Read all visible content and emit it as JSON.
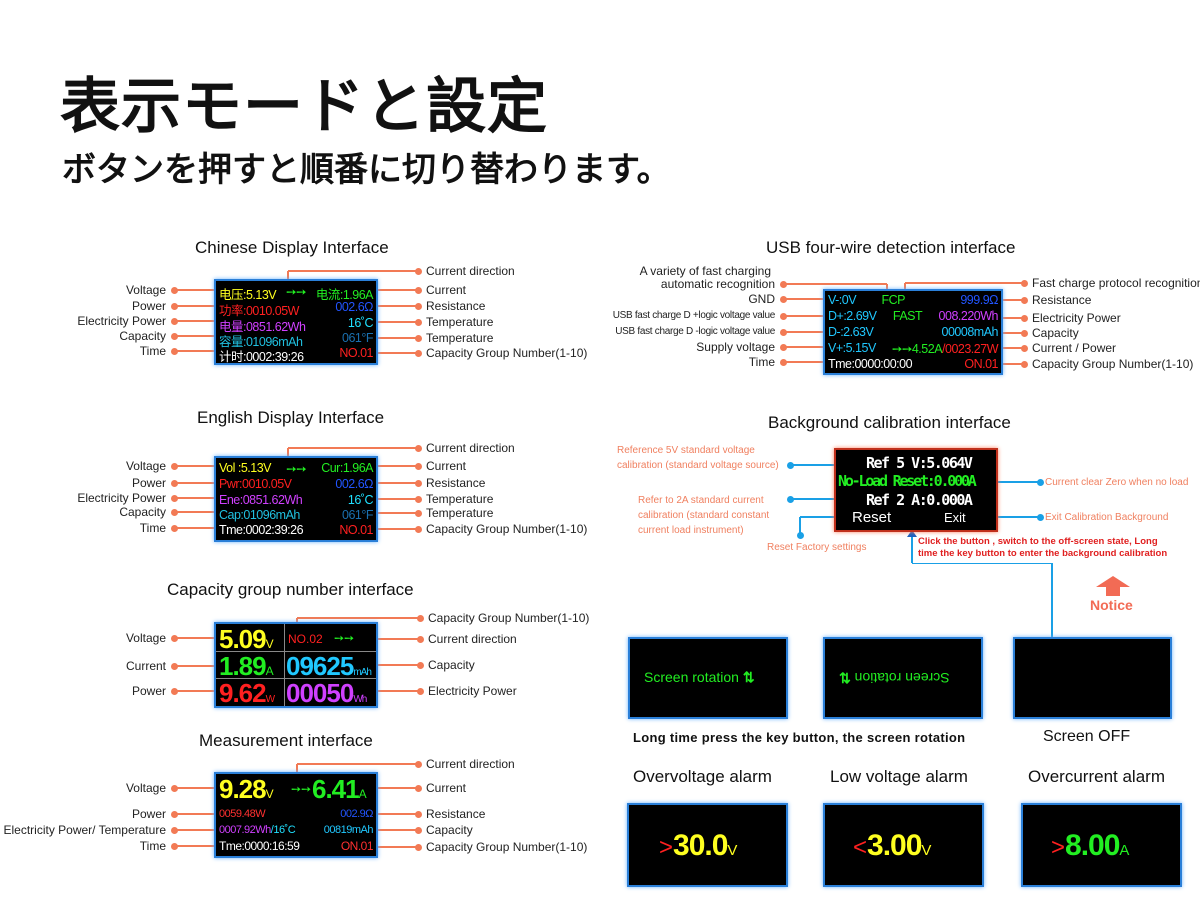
{
  "header": {
    "title": "表示モードと設定",
    "subtitle": "ボタンを押すと順番に切り替わります。"
  },
  "colors": {
    "label_line": "#f27a55",
    "calib_line": "#1aa0e6",
    "yellow": "#ffff20",
    "green": "#22ee22",
    "red": "#ff2020",
    "blue": "#2255ff",
    "cyan": "#20d0ff",
    "magenta": "#d040ff",
    "white": "#ffffff",
    "notice": "#f26b55"
  },
  "chinese": {
    "title": "Chinese Display Interface",
    "screen": {
      "r1l": "电压:5.13V",
      "arrow": "➙➙",
      "r1r": "电流:1.96A",
      "r2l": "功率:0010.05W",
      "r2r": "002.6Ω",
      "r3l": "电量:0851.62Wh",
      "r3r": "16˚C",
      "r4l": "容量:01096mAh",
      "r4r": "061°F",
      "r5l": "计时:0002:39:26",
      "r5r": "NO.01"
    },
    "left": [
      "Voltage",
      "Power",
      "Electricity Power",
      "Capacity",
      "Time"
    ],
    "right": [
      "Current direction",
      "Current",
      "Resistance",
      "Temperature",
      "Temperature",
      "Capacity Group Number(1-10)"
    ]
  },
  "english": {
    "title": "English Display Interface",
    "screen": {
      "r1l": "Vol :5.13V",
      "arrow": "➙➙",
      "r1r": "Cur:1.96A",
      "r2l": "Pwr:0010.05V",
      "r2r": "002.6Ω",
      "r3l": "Ene:0851.62Wh",
      "r3r": "16˚C",
      "r4l": "Cap:01096mAh",
      "r4r": "061°F",
      "r5l": "Tme:0002:39:26",
      "r5r": "NO.01"
    },
    "left": [
      "Voltage",
      "Power",
      "Electricity Power",
      "Capacity",
      "Time"
    ],
    "right": [
      "Current direction",
      "Current",
      "Resistance",
      "Temperature",
      "Temperature",
      "Capacity Group Number(1-10)"
    ]
  },
  "group": {
    "title": "Capacity group number interface",
    "screen": {
      "v": "5.09",
      "vu": "V",
      "no": "NO.02",
      "arrow": "➙➙",
      "a": "1.89",
      "au": "A",
      "cap": "09625",
      "capu": "mAh",
      "w": "9.62",
      "wu": "W",
      "wh": "00050",
      "whu": "Wh"
    },
    "left": [
      "Voltage",
      "Current",
      "Power"
    ],
    "right": [
      "Capacity Group Number(1-10)",
      "Current direction",
      "Capacity",
      "Electricity Power"
    ]
  },
  "measure": {
    "title": "Measurement interface",
    "screen": {
      "v": "9.28",
      "vu": "V",
      "arrow": "➙➙",
      "a": "6.41",
      "au": "A",
      "r2l": "0059.48W",
      "r2r": "002.9Ω",
      "r3l": "0007.92Wh",
      "r3m": "/16˚C",
      "r3r": "00819mAh",
      "r4l": "Tme:0000:16:59",
      "r4r": "ON.01"
    },
    "left": [
      "Voltage",
      "Power",
      "Electricity Power/ Temperature",
      "Time"
    ],
    "right": [
      "Current direction",
      "Current",
      "Resistance",
      "Capacity",
      "Capacity Group Number(1-10)"
    ]
  },
  "usb": {
    "title": "USB four-wire detection interface",
    "screen": {
      "r1l": "V-:0V",
      "r1m": "FCP",
      "r1r": "999.9Ω",
      "r2l": "D+:2.69V",
      "r2m": "FAST",
      "r2r": "008.220Wh",
      "r3l": "D-:2.63V",
      "r3r": "00008mAh",
      "r4l": "V+:5.15V",
      "arrow": "➙➙",
      "r4m": "4.52A",
      "r4r": "/0023.27W",
      "r5l": "Tme:0000:00:00",
      "r5r": "ON.01"
    },
    "left": [
      "A variety of fast charging",
      "automatic recognition",
      "GND",
      "USB fast charge D +logic voltage value",
      "USB fast charge D -logic voltage value",
      "Supply voltage",
      "Time"
    ],
    "right": [
      "Fast charge protocol recognition",
      "Resistance",
      "Electricity Power",
      "Capacity",
      "Current / Power",
      "Capacity Group Number(1-10)"
    ]
  },
  "calibration": {
    "title": "Background calibration interface",
    "screen": {
      "r1": "Ref 5 V:5.064V",
      "r2": "No-Load Reset:0.000A",
      "r3": "Ref 2 A:0.000A",
      "reset": "Reset",
      "exit": "Exit"
    },
    "notes": {
      "ref5_1": "Reference 5V standard voltage",
      "ref5_2": "calibration (standard voltage source)",
      "ref2_1": "Refer to 2A standard current",
      "ref2_2": "calibration (standard constant",
      "ref2_3": "current load instrument)",
      "reset": "Reset Factory settings",
      "clear": "Current clear Zero when no load",
      "exit": "Exit Calibration Background",
      "click_1": "Click the button , switch to the off-screen state, Long",
      "click_2": "time the key button to enter the background calibration"
    }
  },
  "notice": {
    "label": "Notice"
  },
  "rotation": {
    "normal": "Screen rotation",
    "flipped": "Screen rotation",
    "caption": "Long time press the key button, the screen rotation",
    "off_caption": "Screen OFF"
  },
  "alarms": [
    {
      "title": "Overvoltage alarm",
      "sign": ">",
      "value": "30.0",
      "unit": "V"
    },
    {
      "title": "Low voltage alarm",
      "sign": "<",
      "value": "3.00",
      "unit": "V"
    },
    {
      "title": "Overcurrent alarm",
      "sign": ">",
      "value": "8.00",
      "unit": "A"
    }
  ]
}
